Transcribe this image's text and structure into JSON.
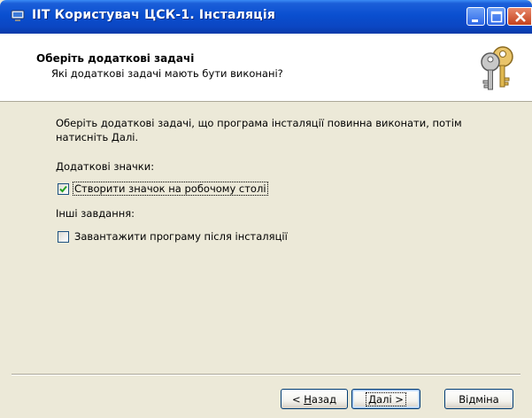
{
  "window": {
    "title": "ІІТ Користувач ЦСК-1. Інсталяція"
  },
  "header": {
    "title": "Оберіть додаткові задачі",
    "subtitle": "Які додаткові задачі мають бути виконані?"
  },
  "body": {
    "instruction_line1": "Оберіть додаткові задачі, що програма інсталяції повинна виконати, потім",
    "instruction_line2": "натисніть Далі.",
    "group1_label": "Додаткові значки:",
    "desktop_icon_label": "Створити значок на робочому столі",
    "desktop_icon_checked": true,
    "group2_label": "Інші завдання:",
    "launch_label": "Завантажити програму після інсталяції",
    "launch_checked": false
  },
  "buttons": {
    "back_prefix": "< ",
    "back_mnemonic": "Н",
    "back_rest": "азад",
    "next_mnemonic": "Д",
    "next_rest": "алі",
    "next_suffix": " >",
    "cancel_label": "Відміна"
  },
  "colors": {
    "titlebar": "#0A4FD0",
    "dialog_bg": "#ECE9D8",
    "close_button": "#C4421D",
    "checkbox_check": "#21A121"
  }
}
